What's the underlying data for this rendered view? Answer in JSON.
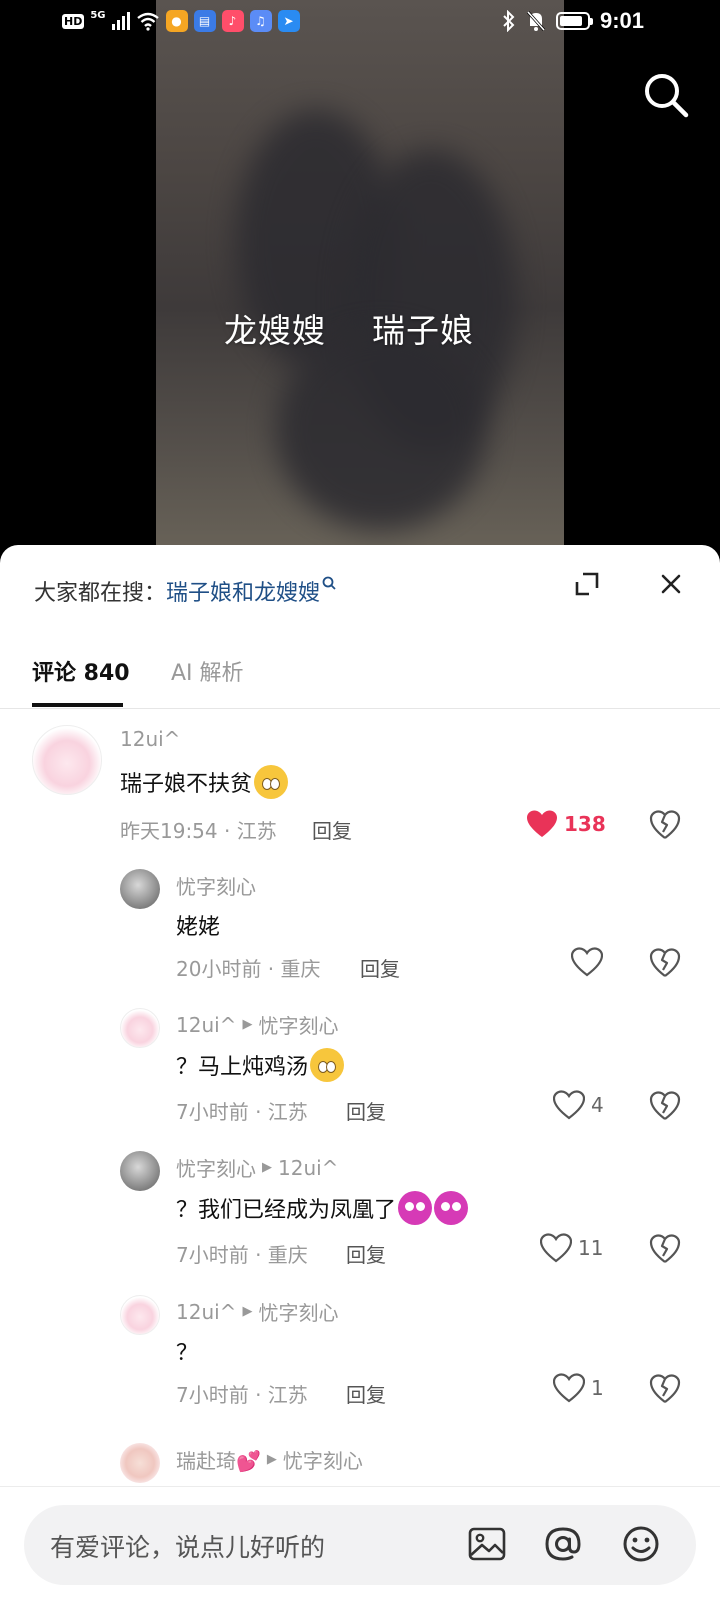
{
  "status_bar": {
    "time": "9:01",
    "hd_label": "HD",
    "network": "5G",
    "battery_level": 0.85
  },
  "video": {
    "caption": "龙嫂嫂    瑞子娘"
  },
  "sheet": {
    "hot_search_label": "大家都在搜：",
    "hot_search_term": "瑞子娘和龙嫂嫂",
    "tab_comments": "评论 840",
    "tab_ai": "AI 解析"
  },
  "comments": [
    {
      "name": "12ui^",
      "text": "瑞子娘不扶贫",
      "emoji": [
        "cry"
      ],
      "meta": "昨天19:54 · 江苏",
      "reply": "回复",
      "likes": "138",
      "liked": true
    },
    {
      "name": "忧字刻心",
      "text": "姥姥",
      "meta": "20小时前 · 重庆",
      "reply": "回复",
      "likes": ""
    },
    {
      "name": "12ui^",
      "reply_to": "忧字刻心",
      "text": "？马上炖鸡汤",
      "emoji": [
        "cry"
      ],
      "meta": "7小时前 · 江苏",
      "reply": "回复",
      "likes": "4"
    },
    {
      "name": "忧字刻心",
      "reply_to": "12ui^",
      "text": "？我们已经成为凤凰了",
      "emoji": [
        "devil",
        "devil"
      ],
      "meta": "7小时前 · 重庆",
      "reply": "回复",
      "likes": "11"
    },
    {
      "name": "12ui^",
      "reply_to": "忧字刻心",
      "text": "？",
      "meta": "7小时前 · 江苏",
      "reply": "回复",
      "likes": "1"
    },
    {
      "name": "瑞赴琦💕",
      "reply_to": "忧字刻心"
    }
  ],
  "input": {
    "placeholder": "有爱评论，说点儿好听的"
  },
  "colors": {
    "like_red": "#e93358",
    "link_blue": "#1f4f86"
  }
}
